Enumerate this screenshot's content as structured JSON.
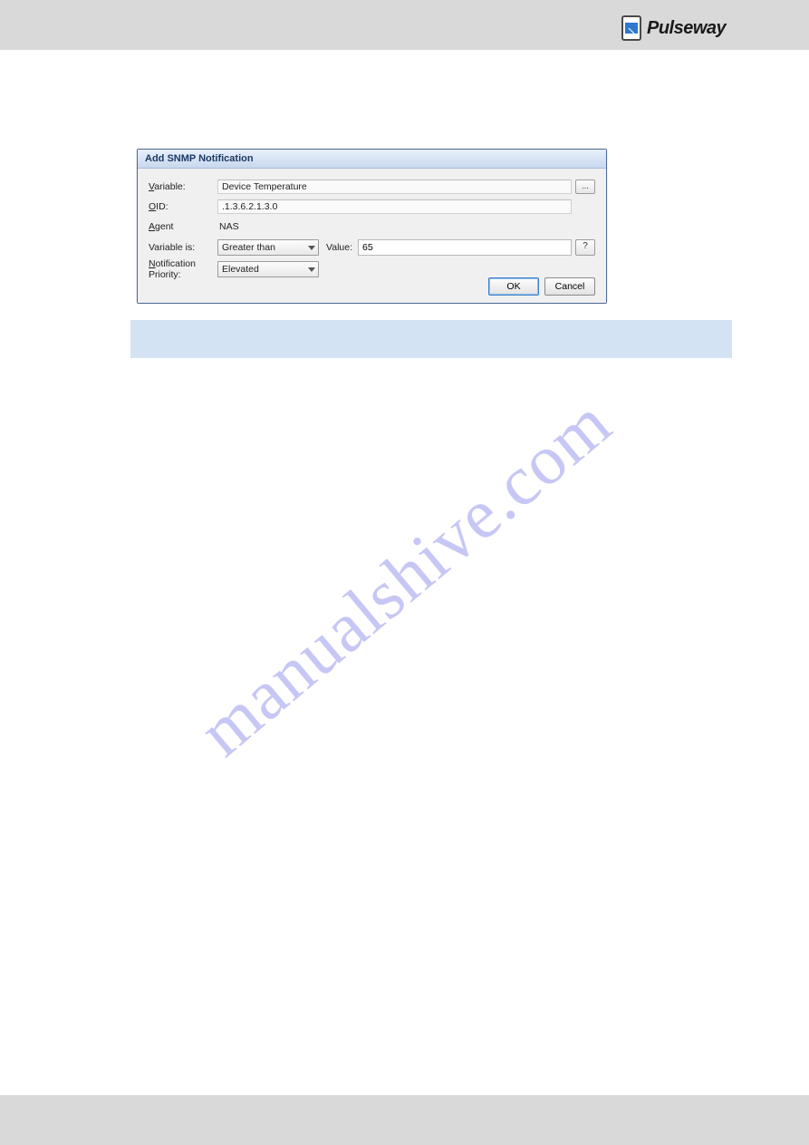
{
  "header": {
    "brand_name": "Pulseway"
  },
  "dialog": {
    "title": "Add SNMP Notification",
    "fields": {
      "variable_label": "Variable:",
      "variable_value": "Device Temperature",
      "oid_label": "OID:",
      "oid_value": ".1.3.6.2.1.3.0",
      "agent_label": "Agent",
      "agent_value": "NAS",
      "variable_is_label": "Variable is:",
      "variable_is_value": "Greater than",
      "value_label": "Value:",
      "value_value": "65",
      "help_label": "?",
      "priority_label": "Notification Priority:",
      "priority_value": "Elevated",
      "ellipsis_label": "..."
    },
    "buttons": {
      "ok": "OK",
      "cancel": "Cancel"
    }
  },
  "watermark": "manualshive.com"
}
